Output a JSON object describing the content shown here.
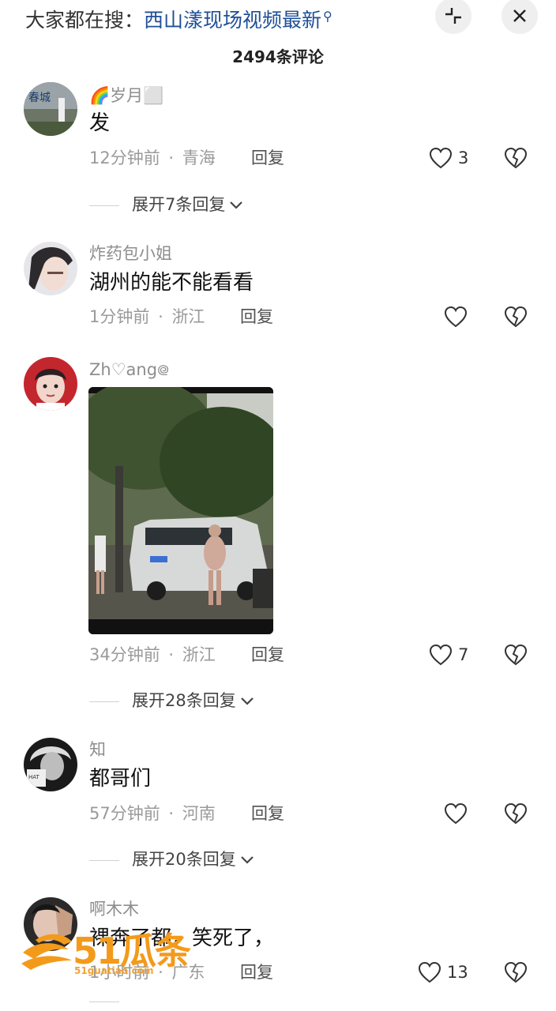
{
  "header": {
    "search_prefix": "大家都在搜：",
    "search_term": "西山漾现场视频最新",
    "search_icon": "search-icon",
    "collapse_icon": "collapse-icon",
    "close_icon": "close-icon",
    "comment_count": "2494条评论"
  },
  "colors": {
    "search_link": "#1f4f97",
    "meta_gray": "#9a9a9a",
    "watermark_orange": "#f39a1b"
  },
  "comments": [
    {
      "username": "🌈岁月⬜",
      "text": "发",
      "time": "12分钟前",
      "sep": "·",
      "location": "青海",
      "reply_label": "回复",
      "likes": "3",
      "expand_label": "展开7条回复"
    },
    {
      "username": "炸药包小姐",
      "text": "湖州的能不能看看",
      "time": "1分钟前",
      "sep": "·",
      "location": "浙江",
      "reply_label": "回复",
      "likes": ""
    },
    {
      "username": "Zh♡ang᪤",
      "text": "",
      "time": "34分钟前",
      "sep": "·",
      "location": "浙江",
      "reply_label": "回复",
      "likes": "7",
      "expand_label": "展开28条回复"
    },
    {
      "username": "知",
      "text": "都哥们",
      "time": "57分钟前",
      "sep": "·",
      "location": "河南",
      "reply_label": "回复",
      "likes": "",
      "expand_label": "展开20条回复"
    },
    {
      "username": "啊木木",
      "text": "裸奔了都，笑死了，",
      "time": "1小时前",
      "sep": "·",
      "location": "广东",
      "reply_label": "回复",
      "likes": "13"
    }
  ],
  "watermark": {
    "big": "51瓜条",
    "small": "51guatiao.com"
  }
}
